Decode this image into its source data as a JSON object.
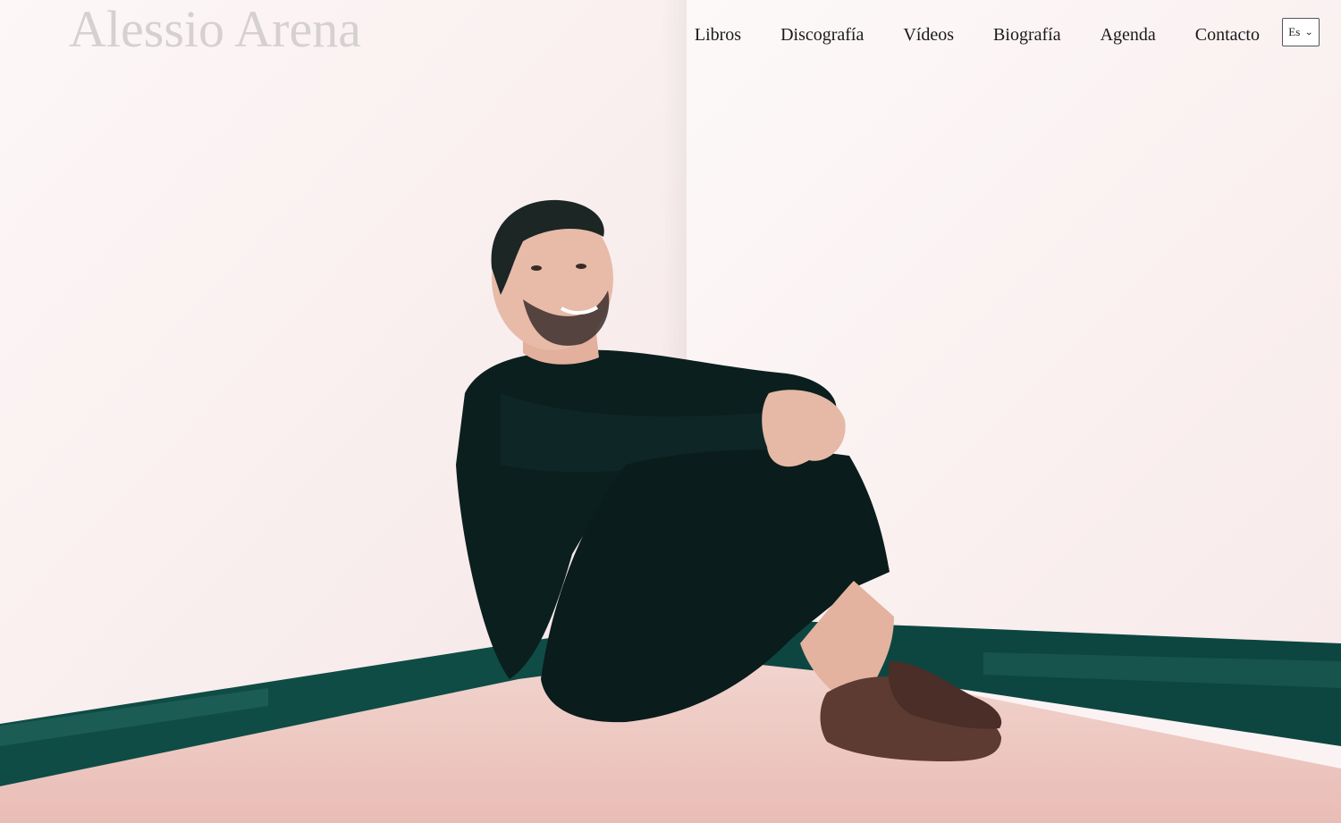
{
  "header": {
    "site_title": "Alessio Arena",
    "language": "Es"
  },
  "nav": {
    "items": [
      {
        "label": "Libros"
      },
      {
        "label": "Discografía"
      },
      {
        "label": "Vídeos"
      },
      {
        "label": "Biografía"
      },
      {
        "label": "Agenda"
      },
      {
        "label": "Contacto"
      }
    ]
  },
  "hero": {
    "icon": "hero-photo"
  },
  "colors": {
    "title": "#d5d1d0",
    "nav_text": "#1a1a1a",
    "wall": "#fbf3f3",
    "baseboard": "#0f4c45",
    "floor": "#eec6c0",
    "clothing": "#0b1f1e"
  }
}
